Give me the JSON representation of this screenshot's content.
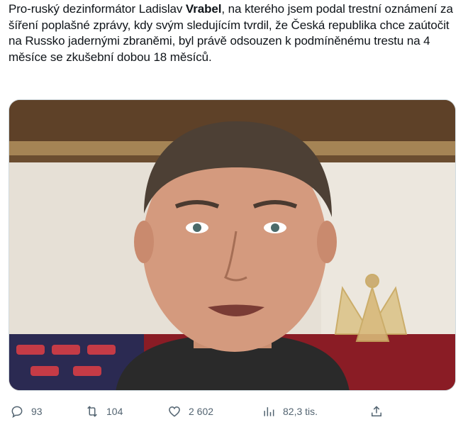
{
  "tweet": {
    "text_before": "Pro-ruský dezinformátor Ladislav ",
    "text_bold": "Vrabel",
    "text_after": ", na kterého jsem podal trestní oznámení za šíření poplašné zprávy, kdy svým sledujícím tvrdil, že Česká republika chce zaútočit na Russko jadernými zbraněmi, byl právě odsouzen k podmíněnému trestu na 4 měsíce se zkušební dobou 18 měsíců."
  },
  "media": {
    "description_icon": "video-still"
  },
  "actions": {
    "replies": "93",
    "reposts": "104",
    "likes": "2 602",
    "views": "82,3 tis."
  },
  "icons": {
    "reply": "reply-icon",
    "repost": "repost-icon",
    "like": "like-icon",
    "views": "views-icon",
    "share": "share-icon"
  },
  "colors": {
    "text": "#0f1419",
    "muted": "#536471",
    "border": "#cfd9de"
  }
}
